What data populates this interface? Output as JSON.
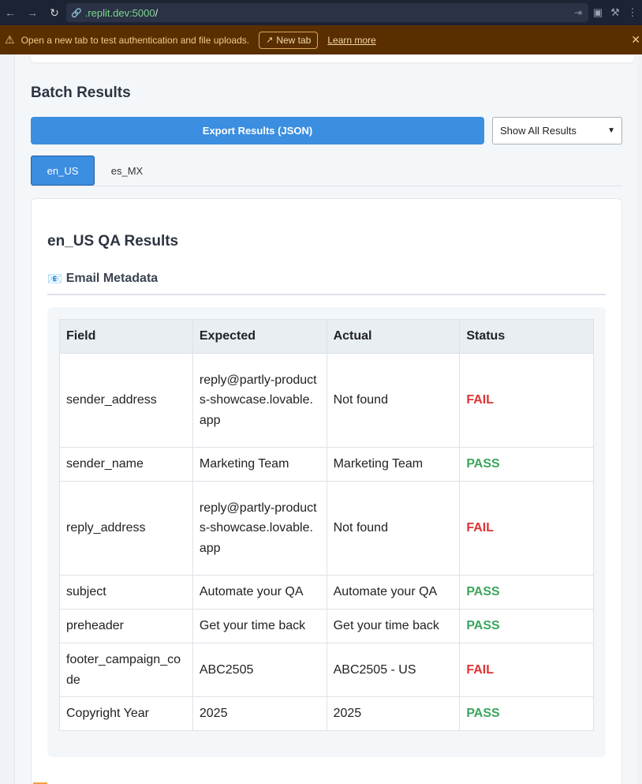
{
  "browser": {
    "url_host": ".replit.dev:5000",
    "url_path": "/"
  },
  "banner": {
    "message": "Open a new tab to test authentication and file uploads.",
    "new_tab_label": "New tab",
    "learn_more_label": "Learn more"
  },
  "page": {
    "section_title": "Batch Results",
    "export_label": "Export Results (JSON)",
    "filter_selected": "Show All Results"
  },
  "tabs": [
    {
      "label": "en_US",
      "active": true
    },
    {
      "label": "es_MX",
      "active": false
    }
  ],
  "results": {
    "title": "en_US QA Results",
    "metadata_heading": "Email Metadata",
    "metadata_icon": "envelope-icon",
    "columns": [
      "Field",
      "Expected",
      "Actual",
      "Status"
    ],
    "rows": [
      {
        "field": "sender_address",
        "expected": "reply@partly-products-showcase.lovable.app",
        "actual": "Not found",
        "status": "FAIL"
      },
      {
        "field": "sender_name",
        "expected": "Marketing Team",
        "actual": "Marketing Team",
        "status": "PASS"
      },
      {
        "field": "reply_address",
        "expected": "reply@partly-products-showcase.lovable.app",
        "actual": "Not found",
        "status": "FAIL"
      },
      {
        "field": "subject",
        "expected": "Automate your QA",
        "actual": "Automate your QA",
        "status": "PASS"
      },
      {
        "field": "preheader",
        "expected": "Get your time back",
        "actual": "Get your time back",
        "status": "PASS"
      },
      {
        "field": "footer_campaign_code",
        "expected": "ABC2505",
        "actual": "ABC2505 - US",
        "status": "FAIL"
      },
      {
        "field": "Copyright Year",
        "expected": "2025",
        "actual": "2025",
        "status": "PASS"
      }
    ]
  },
  "colors": {
    "accent": "#3b8ee0",
    "fail": "#dd3333",
    "pass": "#3aa55c",
    "banner_bg": "#5a2f00"
  }
}
